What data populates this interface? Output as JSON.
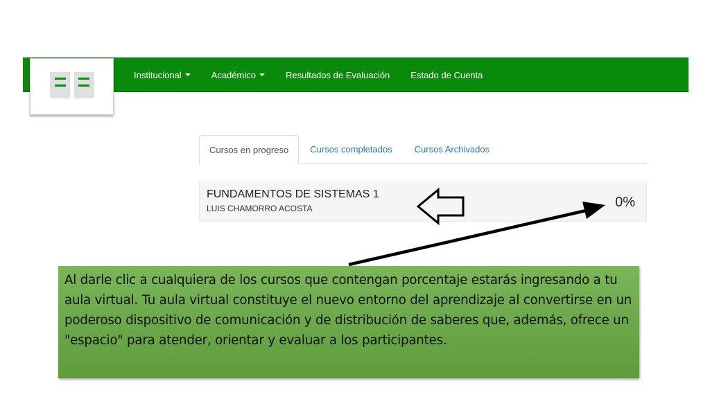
{
  "colors": {
    "navbar": "#0a8a0a",
    "link": "#2a74c0",
    "callout": "#6aa84a"
  },
  "logo": {
    "icon": "institution-logo-icon"
  },
  "nav": {
    "items": [
      {
        "label": "Institucional",
        "dropdown": true
      },
      {
        "label": "Académico",
        "dropdown": true
      },
      {
        "label": "Resultados de Evaluación",
        "dropdown": false
      },
      {
        "label": "Estado de Cuenta",
        "dropdown": false
      }
    ]
  },
  "tabs": [
    {
      "label": "Cursos en progreso",
      "active": true
    },
    {
      "label": "Cursos completados",
      "active": false
    },
    {
      "label": "Cursos Archivados",
      "active": false
    }
  ],
  "course": {
    "title": "FUNDAMENTOS DE SISTEMAS 1",
    "teacher": "LUIS CHAMORRO ACOSTA",
    "progress": "0%"
  },
  "annotations": {
    "outline_arrow_icon": "outline-arrow-left-icon",
    "pointer_arrow_icon": "pointer-arrow-icon"
  },
  "callout": {
    "text": "Al darle clic a cualquiera de los cursos que contengan porcentaje estarás ingresando a tu  aula virtual. Tu aula virtual constituye  el nuevo entorno del aprendizaje al convertirse en un poderoso dispositivo de comunicación y de distribución de saberes que, además, ofrece un \"espacio\" para atender, orientar y evaluar a los participantes."
  }
}
